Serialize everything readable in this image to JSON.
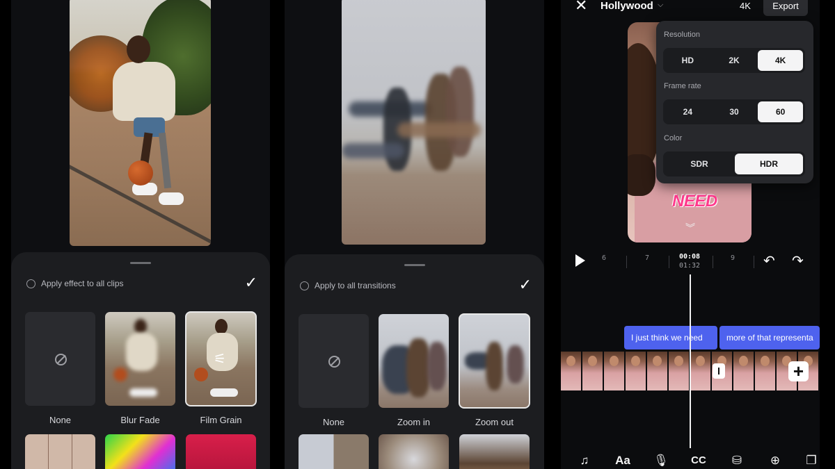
{
  "effects_screen": {
    "apply_label": "Apply effect to all clips",
    "confirm_icon": "checkmark-icon",
    "tiles": [
      {
        "label": "None",
        "selected": false
      },
      {
        "label": "Blur Fade",
        "selected": false
      },
      {
        "label": "Film Grain",
        "selected": true
      }
    ]
  },
  "transitions_screen": {
    "apply_label": "Apply to all transitions",
    "confirm_icon": "checkmark-icon",
    "tiles": [
      {
        "label": "None",
        "selected": false
      },
      {
        "label": "Zoom in",
        "selected": false
      },
      {
        "label": "Zoom out",
        "selected": true
      }
    ]
  },
  "editor": {
    "project_title": "Hollywood",
    "resolution_badge": "4K",
    "export_label": "Export",
    "settings": {
      "resolution": {
        "label": "Resolution",
        "options": [
          "HD",
          "2K",
          "4K"
        ],
        "selected": "4K"
      },
      "frame_rate": {
        "label": "Frame rate",
        "options": [
          "24",
          "30",
          "60"
        ],
        "selected": "60"
      },
      "color": {
        "label": "Color",
        "options": [
          "SDR",
          "HDR"
        ],
        "selected": "HDR"
      }
    },
    "sticker_text": "NEED",
    "timeline": {
      "ticks": [
        "6",
        "7",
        "9"
      ],
      "current_time": "00:08",
      "total_time": "01:32"
    },
    "captions": [
      "I just think we need",
      "more of that representa"
    ],
    "accent_color": "#4e62ee",
    "toolbar_icons": [
      "music-icon",
      "text-icon",
      "microphone-icon",
      "captions-icon",
      "filters-icon",
      "adjust-icon",
      "overlay-icon"
    ],
    "toolbar_text": {
      "text_tool": "Aa",
      "captions_tool": "CC"
    }
  }
}
